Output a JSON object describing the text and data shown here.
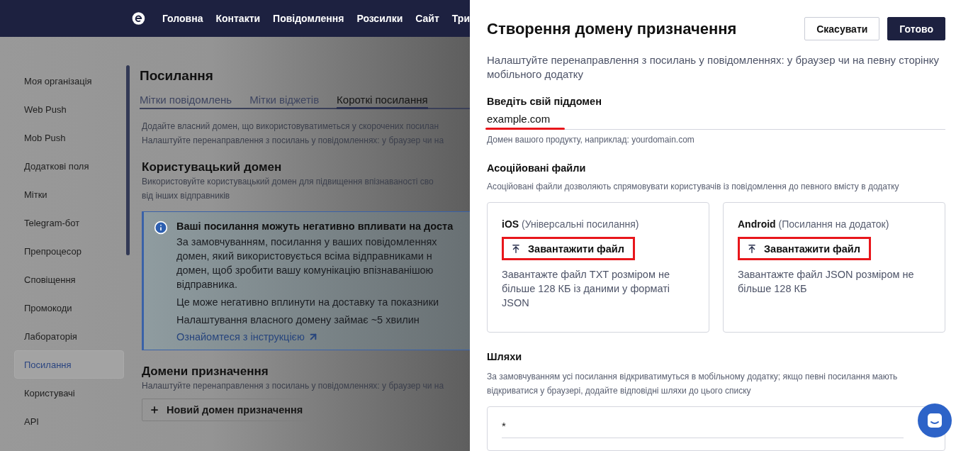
{
  "nav": {
    "items": [
      "Головна",
      "Контакти",
      "Повідомлення",
      "Розсилки",
      "Сайт",
      "Три"
    ]
  },
  "sidebar": {
    "items": [
      {
        "label": "Моя організація",
        "selected": false
      },
      {
        "label": "Web Push",
        "selected": false
      },
      {
        "label": "Mob Push",
        "selected": false
      },
      {
        "label": "Додаткові поля",
        "selected": false
      },
      {
        "label": "Мітки",
        "selected": false
      },
      {
        "label": "Telegram-бот",
        "selected": false
      },
      {
        "label": "Препроцесор",
        "selected": false
      },
      {
        "label": "Сповіщення",
        "selected": false
      },
      {
        "label": "Промокоди",
        "selected": false
      },
      {
        "label": "Лабораторія",
        "selected": false
      },
      {
        "label": "Посилання",
        "selected": true
      },
      {
        "label": "Користувачі",
        "selected": false
      },
      {
        "label": "API",
        "selected": false
      }
    ]
  },
  "page": {
    "title": "Посилання",
    "tabs": [
      {
        "label": "Мітки повідомлень",
        "selected": false
      },
      {
        "label": "Мітки віджетів",
        "selected": false
      },
      {
        "label": "Короткі посилання",
        "selected": true
      }
    ],
    "intro": [
      "Додайте власний домен, що використовуватиметься у скорочених посилан",
      "Налаштуйте перенаправлення з посилань у повідомленнях: у браузер чи на"
    ],
    "custom_domain": {
      "heading": "Користувацький домен",
      "description": [
        "Використовуйте користувацький домен для підвищення впізнаваності сво",
        "від інших відправників"
      ],
      "alert": {
        "title": "Ваші посилання можуть негативно впливати на доста",
        "lines": [
          "За замовчуванням, посилання у ваших повідомленнях",
          "домен, який використовується всіма відправниками н",
          "домен, щоб зробити вашу комунікацію впізнаванішою",
          "відправника."
        ],
        "notes": [
          "Це може негативно вплинути на доставку та показники",
          "Налаштування власного домену займає ~5 хвилин"
        ],
        "link": "Ознайомтеся з інструкцією"
      }
    },
    "destination_domains": {
      "heading": "Домени призначення",
      "description": "Налаштуйте перенаправлення з посилань у повідомленнях: у браузер чи на",
      "add_button": "Новий домен призначення"
    }
  },
  "drawer": {
    "title": "Створення домену призначення",
    "cancel": "Скасувати",
    "done": "Готово",
    "description": "Налаштуйте перенаправлення з посилань у повідомленнях: у браузер чи на певну сторінку мобільного додатку",
    "subdomain": {
      "label": "Введіть свій піддомен",
      "value": "example.com",
      "hint": "Домен вашого продукту, наприклад: yourdomain.com"
    },
    "associated_files": {
      "heading": "Асоційовані файли",
      "description": "Асоційовані файли дозволяють спрямовувати користувачів із повідомлення до певного вмісту в додатку",
      "cards": [
        {
          "platform": "iOS",
          "subtitle": "(Універсальні посилання)",
          "upload_button": "Завантажити файл",
          "note": "Завантажте файл TXT розміром не більше 128 КБ із даними у форматі JSON"
        },
        {
          "platform": "Android",
          "subtitle": "(Посилання на додаток)",
          "upload_button": "Завантажити файл",
          "note": "Завантажте файл JSON розміром не більше 128 КБ"
        }
      ]
    },
    "paths": {
      "heading": "Шляхи",
      "description": "За замовчуванням усі посилання відкриватимуться в мобільному додатку; якщо певні посилання мають відкриватися у браузері, додайте відповідні шляхи до цього списку",
      "value": "*"
    }
  }
}
